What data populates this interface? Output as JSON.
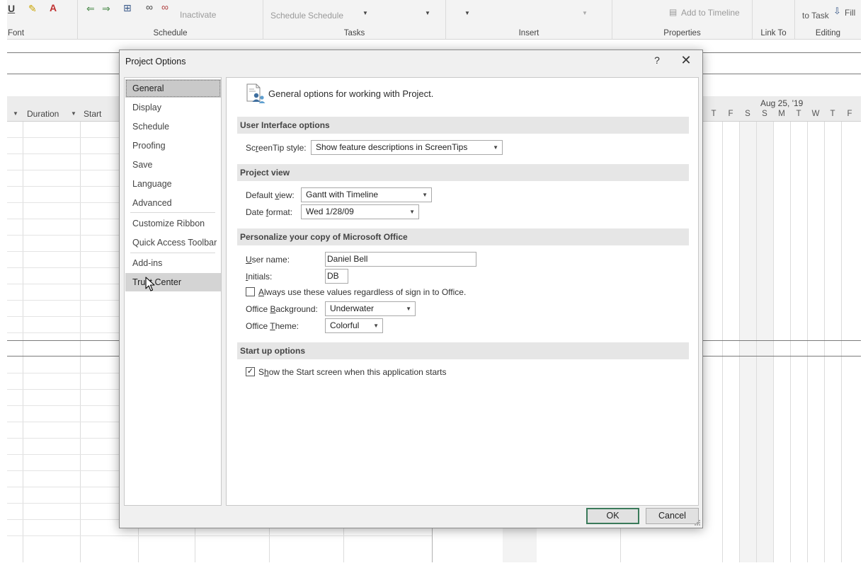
{
  "ribbon": {
    "font_label": "Font",
    "schedule_label": "Schedule",
    "tasks_label": "Tasks",
    "insert_label": "Insert",
    "properties_label": "Properties",
    "linkto_label": "Link To",
    "editing_label": "Editing",
    "inactivate_label": "Inactivate",
    "manually_schedule": "Schedule",
    "auto_schedule": "Schedule",
    "add_to_timeline": "Add to Timeline",
    "scroll_to_task": "to Task",
    "fill_label": "Fill"
  },
  "grid": {
    "col_duration": "Duration",
    "col_start": "Start",
    "week_label": "Aug 25, '19",
    "days_left": [
      "T",
      "F",
      "S"
    ],
    "days_right": [
      "S",
      "M",
      "T",
      "W",
      "T",
      "F"
    ]
  },
  "dialog": {
    "title": "Project Options",
    "help_glyph": "?",
    "close_glyph": "✕",
    "nav": [
      {
        "label": "General"
      },
      {
        "label": "Display"
      },
      {
        "label": "Schedule"
      },
      {
        "label": "Proofing"
      },
      {
        "label": "Save"
      },
      {
        "label": "Language"
      },
      {
        "label": "Advanced"
      },
      {
        "label": "Customize Ribbon"
      },
      {
        "label": "Quick Access Toolbar"
      },
      {
        "label": "Add-ins"
      },
      {
        "label": "Trust Center"
      }
    ],
    "header": "General options for working with Project.",
    "sections": {
      "ui": "User Interface options",
      "project_view": "Project view",
      "personalize": "Personalize your copy of Microsoft Office",
      "startup": "Start up options"
    },
    "screentip": {
      "label_pre": "Sc",
      "label_u": "r",
      "label_post": "eenTip style:",
      "value": "Show feature descriptions in ScreenTips"
    },
    "default_view": {
      "label_pre": "Default ",
      "label_u": "v",
      "label_post": "iew:",
      "value": "Gantt with Timeline"
    },
    "date_format": {
      "label_pre": "Date ",
      "label_u": "f",
      "label_post": "ormat:",
      "value": "Wed 1/28/09"
    },
    "user_name": {
      "label_pre": "",
      "label_u": "U",
      "label_post": "ser name:",
      "value": "Daniel Bell"
    },
    "initials": {
      "label_pre": "",
      "label_u": "I",
      "label_post": "nitials:",
      "value": "DB"
    },
    "always_use": {
      "label_pre": "",
      "label_u": "A",
      "label_post": "lways use these values regardless of sign in to Office.",
      "checked": false
    },
    "office_background": {
      "label_pre": "Office ",
      "label_u": "B",
      "label_post": "ackground:",
      "value": "Underwater"
    },
    "office_theme": {
      "label_pre": "Office ",
      "label_u": "T",
      "label_post": "heme:",
      "value": "Colorful"
    },
    "show_start": {
      "label_pre": "S",
      "label_u": "h",
      "label_post": "ow the Start screen when this application starts",
      "checked": true,
      "check_glyph": "✓"
    },
    "ok_label": "OK",
    "cancel_label": "Cancel",
    "dropdown_arrow": "▼"
  },
  "colors": {
    "default_button_border": "#3a7a5a",
    "section_bg": "#e6e6e6",
    "nav_selected_bg": "#c9c9c9"
  }
}
